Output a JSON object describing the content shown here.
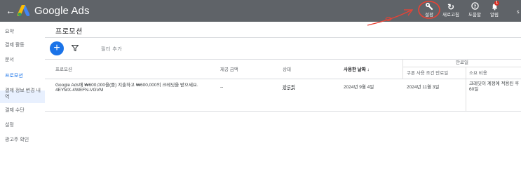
{
  "header": {
    "app_name": "Google Ads",
    "tools": [
      {
        "label": "설정",
        "icon": "wrench-icon"
      },
      {
        "label": "새로고침",
        "icon": "refresh-icon"
      },
      {
        "label": "도움말",
        "icon": "help-icon"
      },
      {
        "label": "알림",
        "icon": "bell-icon",
        "badge": "1"
      }
    ],
    "brand_color": "#5f6368",
    "annotation_color": "#e94235"
  },
  "sidebar": {
    "items": [
      {
        "label": "요약"
      },
      {
        "label": "결제 활동"
      },
      {
        "label": "문서"
      },
      {
        "label": "프로모션",
        "active": true
      },
      {
        "label": "결제 정보 변경 내역"
      },
      {
        "label": "결제 수단"
      },
      {
        "label": "설정"
      },
      {
        "label": "광고주 확인"
      }
    ],
    "active_color": "#1a73e8"
  },
  "main": {
    "title": "프로모션",
    "filter_add": "필터 추가",
    "table": {
      "headers": {
        "promotion": "프로모션",
        "amount": "제공 금액",
        "status": "상태",
        "used_date": "사용한 날짜",
        "expiry": "만료일",
        "coupon_deadline": "쿠폰 사용 조건 만료일",
        "duration": "소요 비용"
      },
      "rows": [
        {
          "promotion_line1": "Google Ads에 ₩600,000을(를) 지출하고 ₩600,000의 크레딧을 받으세요.",
          "promotion_line2": "4EYMX-4WEFN-VGVM",
          "amount": "--",
          "status": "완료됨",
          "used_date": "2024년 9월 4일",
          "coupon_deadline": "2024년 11월 3일",
          "duration_line1": "크레딧이 계정에 적용된 후",
          "duration_line2": "60일"
        }
      ]
    }
  }
}
